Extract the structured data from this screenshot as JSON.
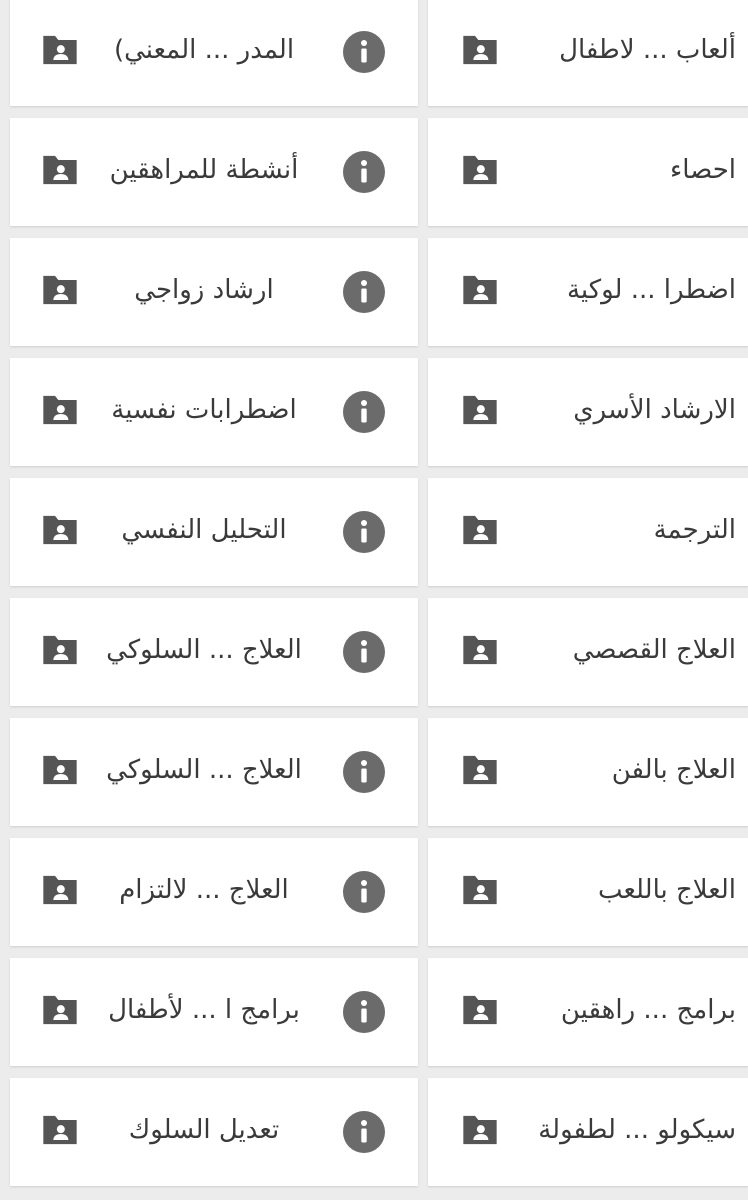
{
  "colors": {
    "background": "#ececec",
    "card": "#ffffff",
    "icon": "#555555",
    "info_icon": "#6b6b6b",
    "text": "#3a3a3a"
  },
  "icons": {
    "folder": "shared-folder-icon",
    "info": "info-icon"
  },
  "folders": [
    {
      "right": "ألعاب ... لاطفال",
      "left": "المدر ... المعني)"
    },
    {
      "right": "احصاء",
      "left": "أنشطة للمراهقين"
    },
    {
      "right": "اضطرا ... لوكية",
      "left": "ارشاد زواجي"
    },
    {
      "right": "الارشاد الأسري",
      "left": "اضطرابات نفسية"
    },
    {
      "right": "الترجمة",
      "left": "التحليل النفسي"
    },
    {
      "right": "العلاج القصصي",
      "left": "العلاج ... السلوكي"
    },
    {
      "right": "العلاج بالفن",
      "left": "العلاج ... السلوكي"
    },
    {
      "right": "العلاج باللعب",
      "left": "العلاج ... لالتزام"
    },
    {
      "right": "برامج ... راهقين",
      "left": "برامج ا ... لأطفال"
    },
    {
      "right": "سيكولو ... لطفولة",
      "left": "تعديل السلوك"
    }
  ]
}
